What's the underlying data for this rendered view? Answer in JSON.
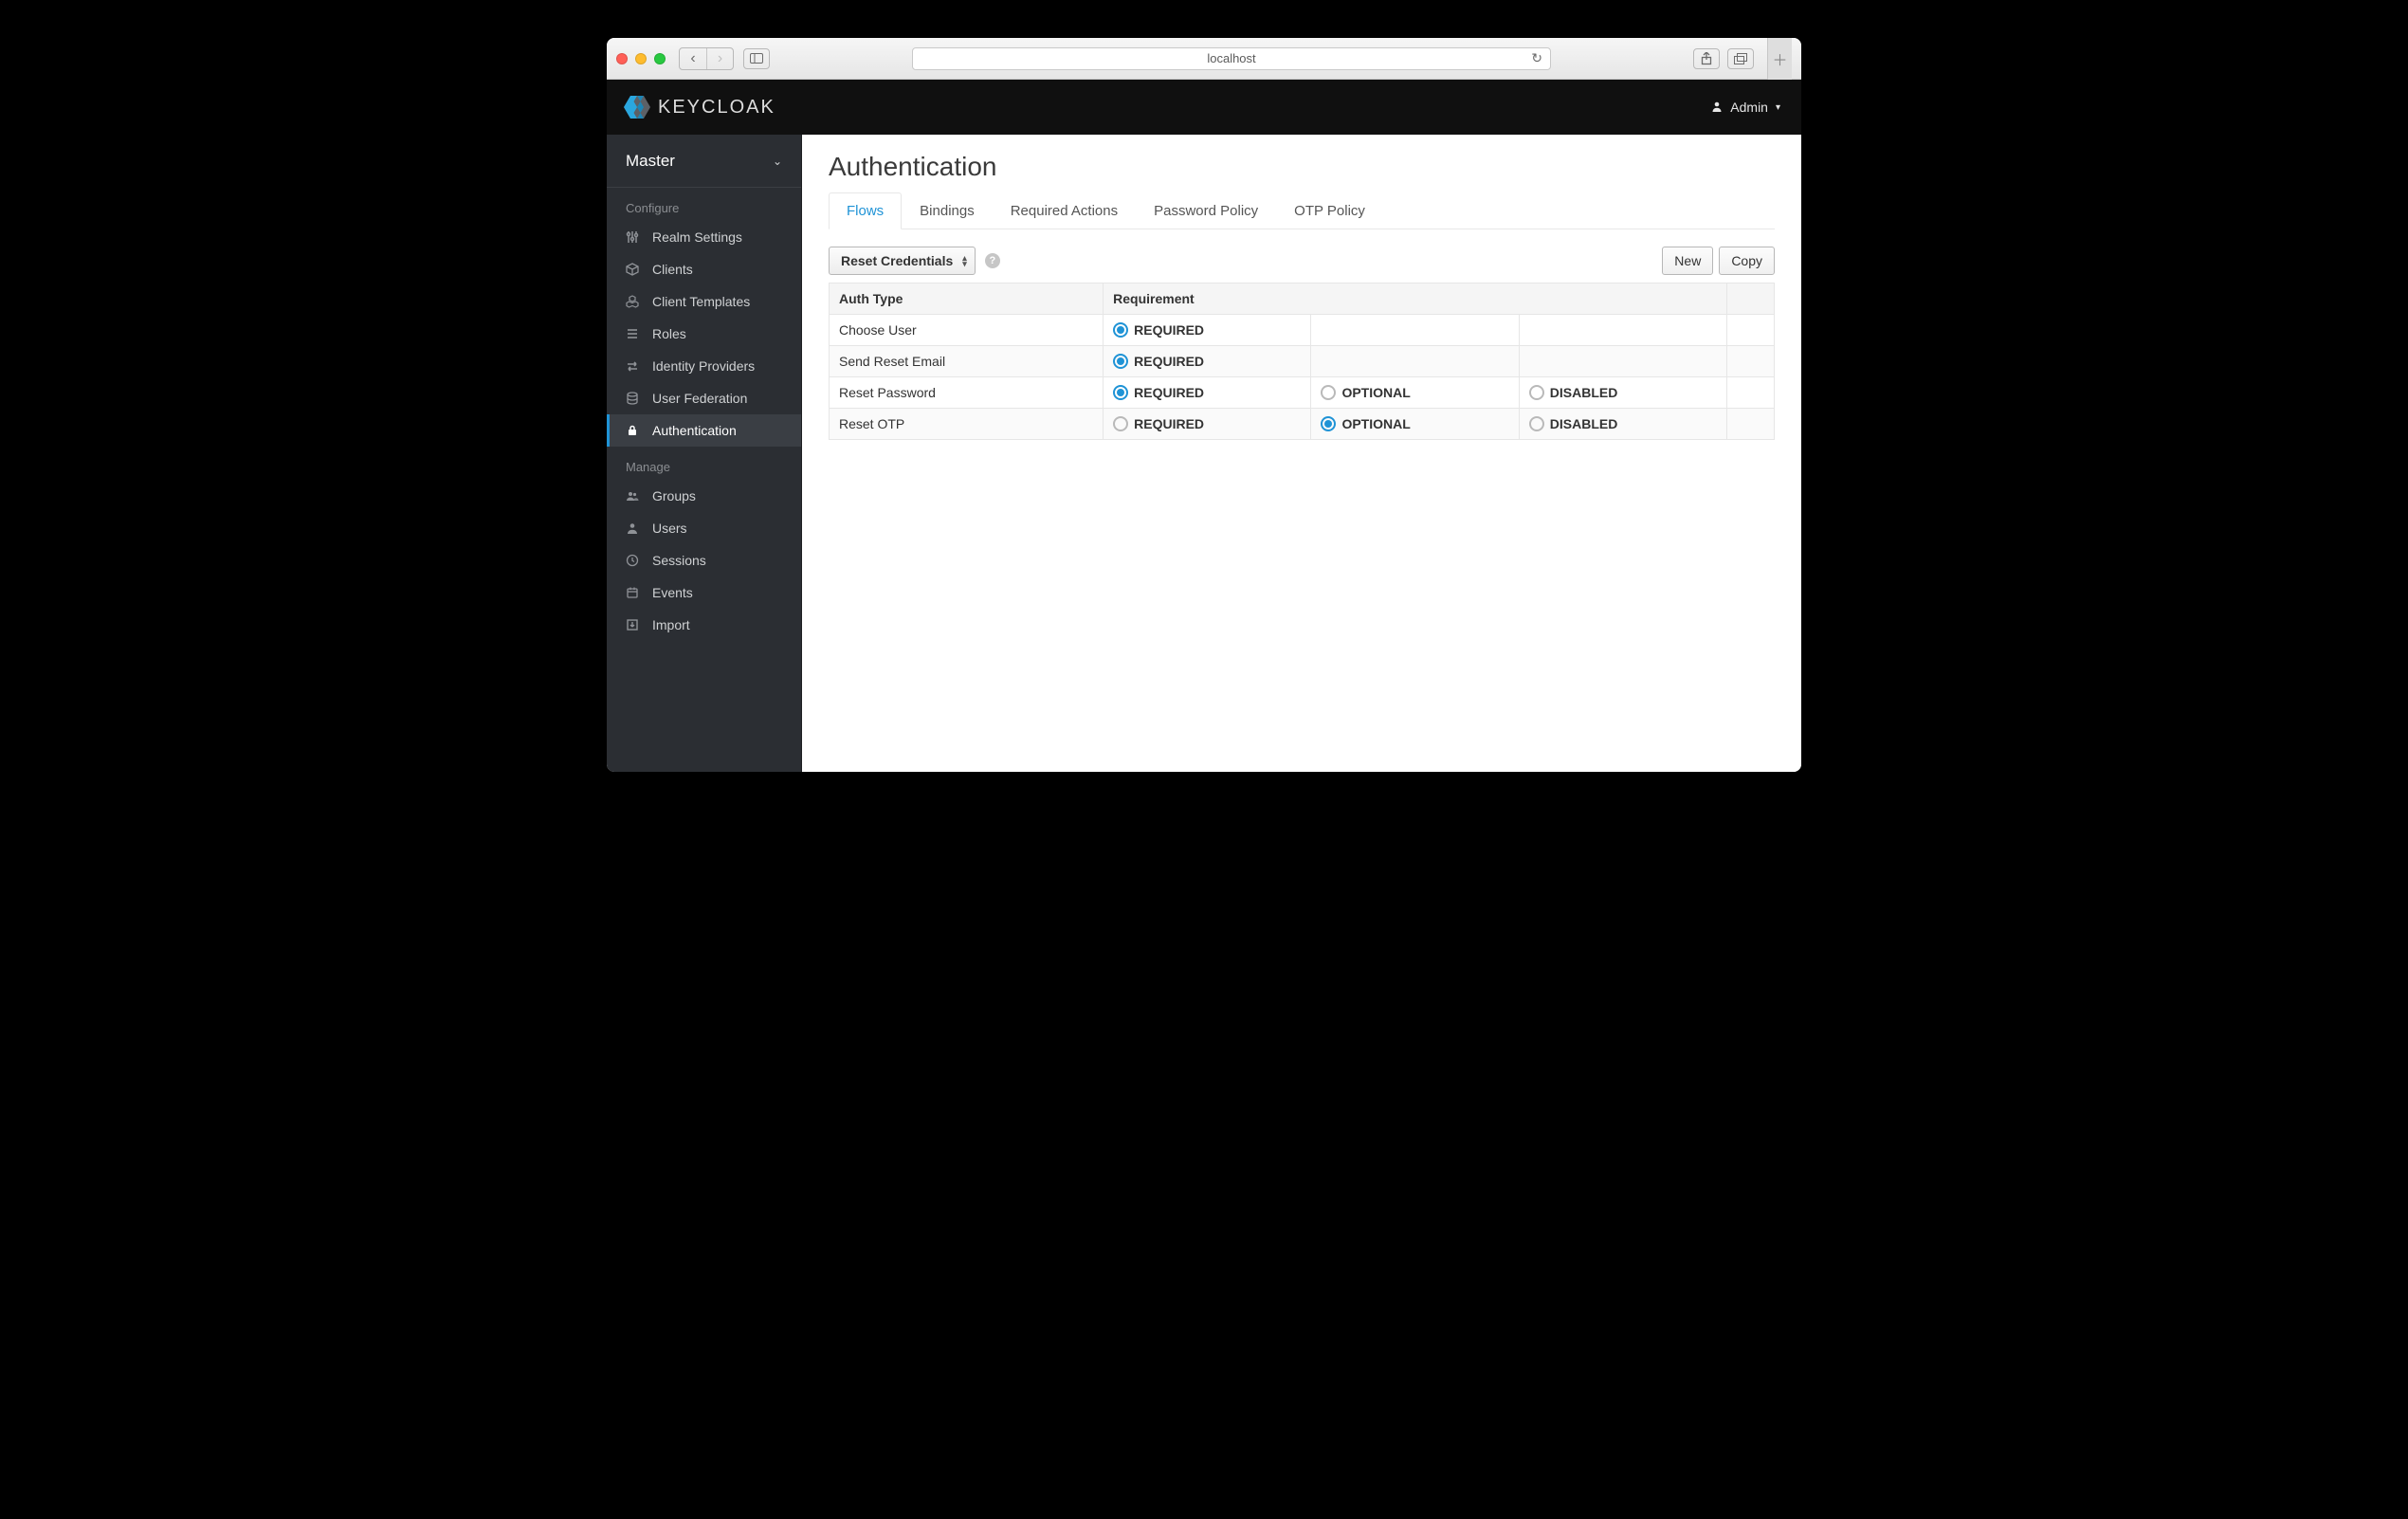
{
  "browser": {
    "url_label": "localhost"
  },
  "header": {
    "brand": "KEYCLOAK",
    "user_label": "Admin"
  },
  "sidebar": {
    "realm": "Master",
    "sections": {
      "configure": "Configure",
      "manage": "Manage"
    },
    "configure_items": [
      {
        "id": "realm-settings",
        "label": "Realm Settings"
      },
      {
        "id": "clients",
        "label": "Clients"
      },
      {
        "id": "client-templates",
        "label": "Client Templates"
      },
      {
        "id": "roles",
        "label": "Roles"
      },
      {
        "id": "identity-providers",
        "label": "Identity Providers"
      },
      {
        "id": "user-federation",
        "label": "User Federation"
      },
      {
        "id": "authentication",
        "label": "Authentication"
      }
    ],
    "manage_items": [
      {
        "id": "groups",
        "label": "Groups"
      },
      {
        "id": "users",
        "label": "Users"
      },
      {
        "id": "sessions",
        "label": "Sessions"
      },
      {
        "id": "events",
        "label": "Events"
      },
      {
        "id": "import",
        "label": "Import"
      }
    ],
    "active_item": "authentication"
  },
  "page": {
    "title": "Authentication",
    "tabs": [
      {
        "id": "flows",
        "label": "Flows",
        "active": true
      },
      {
        "id": "bindings",
        "label": "Bindings"
      },
      {
        "id": "required-actions",
        "label": "Required Actions"
      },
      {
        "id": "password-policy",
        "label": "Password Policy"
      },
      {
        "id": "otp-policy",
        "label": "OTP Policy"
      }
    ],
    "flow_select": "Reset Credentials",
    "buttons": {
      "new": "New",
      "copy": "Copy"
    },
    "columns": {
      "auth_type": "Auth Type",
      "requirement": "Requirement"
    },
    "req_labels": {
      "required": "REQUIRED",
      "optional": "OPTIONAL",
      "disabled": "DISABLED"
    },
    "rows": [
      {
        "name": "Choose User",
        "required": "on",
        "optional": null,
        "disabled": null
      },
      {
        "name": "Send Reset Email",
        "required": "on",
        "optional": null,
        "disabled": null
      },
      {
        "name": "Reset Password",
        "required": "on",
        "optional": "off",
        "disabled": "off"
      },
      {
        "name": "Reset OTP",
        "required": "off",
        "optional": "on",
        "disabled": "off"
      }
    ]
  }
}
